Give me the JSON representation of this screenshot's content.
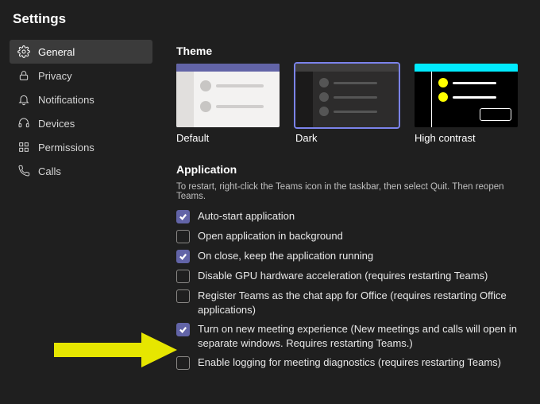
{
  "title": "Settings",
  "sidebar": {
    "items": [
      {
        "label": "General"
      },
      {
        "label": "Privacy"
      },
      {
        "label": "Notifications"
      },
      {
        "label": "Devices"
      },
      {
        "label": "Permissions"
      },
      {
        "label": "Calls"
      }
    ]
  },
  "theme": {
    "heading": "Theme",
    "options": [
      {
        "label": "Default"
      },
      {
        "label": "Dark"
      },
      {
        "label": "High contrast"
      }
    ]
  },
  "application": {
    "heading": "Application",
    "helper": "To restart, right-click the Teams icon in the taskbar, then select Quit. Then reopen Teams.",
    "options": [
      {
        "label": "Auto-start application",
        "checked": true
      },
      {
        "label": "Open application in background",
        "checked": false
      },
      {
        "label": "On close, keep the application running",
        "checked": true
      },
      {
        "label": "Disable GPU hardware acceleration (requires restarting Teams)",
        "checked": false
      },
      {
        "label": "Register Teams as the chat app for Office (requires restarting Office applications)",
        "checked": false
      },
      {
        "label": "Turn on new meeting experience (New meetings and calls will open in separate windows. Requires restarting Teams.)",
        "checked": true
      },
      {
        "label": "Enable logging for meeting diagnostics (requires restarting Teams)",
        "checked": false
      }
    ]
  }
}
